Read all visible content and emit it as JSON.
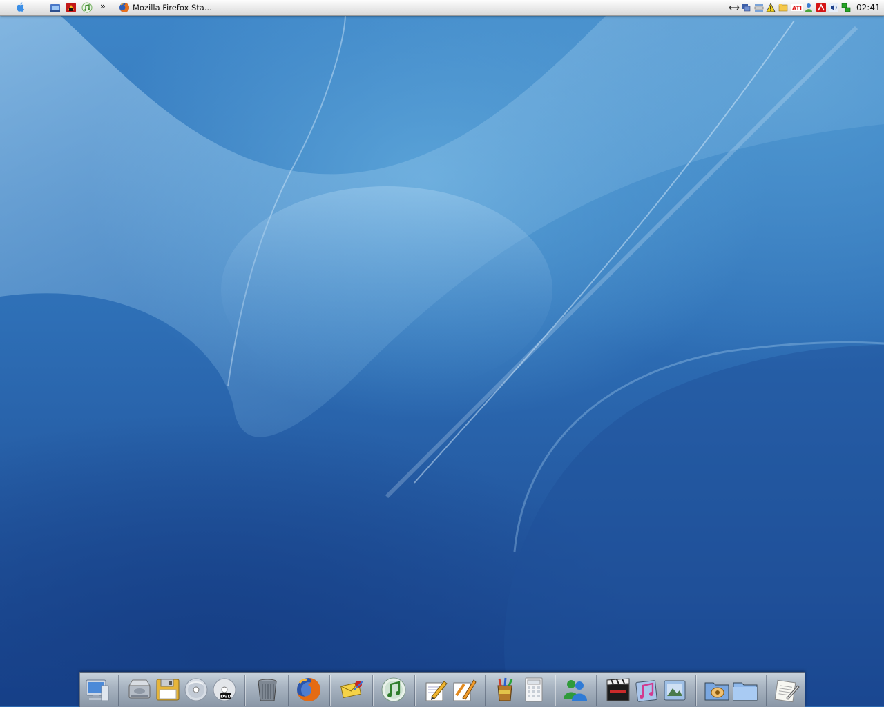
{
  "menubar": {
    "apple_menu_icon": "apple-logo-icon",
    "quick_launch": [
      {
        "name": "show-desktop-icon"
      },
      {
        "name": "media-player-icon"
      },
      {
        "name": "itunes-icon"
      }
    ],
    "overflow_label": "»",
    "active_task": {
      "icon": "firefox-icon",
      "title": "Mozilla Firefox Sta..."
    },
    "tray_icons": [
      "network-arrows-icon",
      "display-icon",
      "connection-icon",
      "security-warning-icon",
      "folder-icon",
      "ati-icon",
      "user-icon",
      "antivirus-icon",
      "volume-icon",
      "network-status-icon"
    ],
    "clock": "02:41"
  },
  "dock": {
    "items": [
      {
        "name": "my-computer-icon"
      },
      {
        "name": "hard-drive-icon"
      },
      {
        "name": "floppy-disk-icon"
      },
      {
        "name": "cd-drive-icon"
      },
      {
        "name": "dvd-drive-icon"
      },
      {
        "name": "trash-icon"
      },
      {
        "name": "firefox-icon"
      },
      {
        "name": "mail-icon"
      },
      {
        "name": "itunes-icon"
      },
      {
        "name": "text-editor-icon"
      },
      {
        "name": "draw-app-icon"
      },
      {
        "name": "paint-app-icon"
      },
      {
        "name": "calculator-icon"
      },
      {
        "name": "msn-messenger-icon"
      },
      {
        "name": "video-icon"
      },
      {
        "name": "music-icon"
      },
      {
        "name": "pictures-icon"
      },
      {
        "name": "documents-icon"
      },
      {
        "name": "folder-icon"
      },
      {
        "name": "notepad-icon"
      }
    ]
  },
  "colors": {
    "wallpaper_top": "#3e86c8",
    "wallpaper_bottom": "#16408a",
    "menubar_bg": "#ececec",
    "dock_bg": "#a9b5c2"
  }
}
